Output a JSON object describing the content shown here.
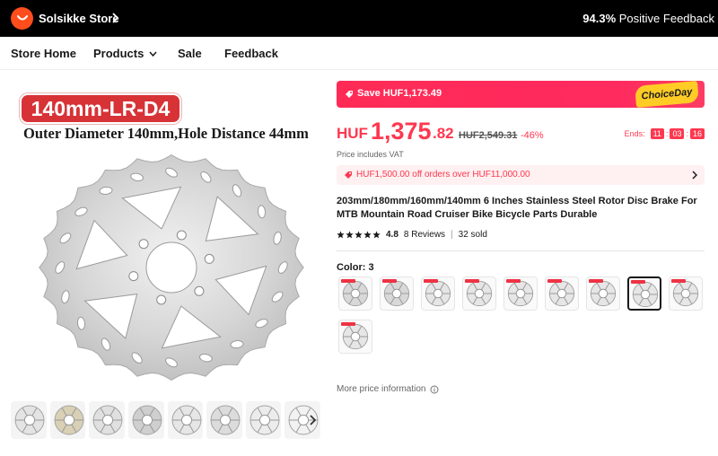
{
  "store": {
    "logo_icon": "aliexpress-logo-icon",
    "name": "Solsikke Store",
    "feedback_pct": "94.3%",
    "feedback_label": "Positive Feedback"
  },
  "nav": {
    "items": [
      "Store Home",
      "Products",
      "Sale",
      "Feedback"
    ]
  },
  "gallery": {
    "badge": "140mm-LR-D4",
    "caption": "Outer Diameter 140mm,Hole Distance 44mm",
    "thumb_count": 8
  },
  "offer": {
    "save_text": "Save HUF1,173.49",
    "choice_badge": "ChoiceDay",
    "currency": "HUF",
    "price_int": "1,375",
    "price_dec": ".82",
    "original_price": "HUF2,549.31",
    "discount": "-46%",
    "ends_label": "Ends:",
    "countdown": [
      "11",
      "03",
      "16"
    ],
    "vat_note": "Price includes VAT",
    "coupon": "HUF1,500.00 off orders over HUF11,000.00"
  },
  "product": {
    "title": "203mm/180mm/160mm/140mm 6 Inches Stainless Steel Rotor Disc Brake For MTB Mountain Road Cruiser Bike Bicycle Parts Durable",
    "rating": "4.8",
    "stars": 5,
    "reviews": "8 Reviews",
    "sold": "32 sold",
    "color_label": "Color: 3",
    "swatch_count": 10,
    "selected_swatch": 7,
    "more_price": "More price information"
  },
  "colors": {
    "accent": "#fd384f",
    "save_bar": "#ff2b56",
    "choice_yellow": "#ffcc26"
  }
}
